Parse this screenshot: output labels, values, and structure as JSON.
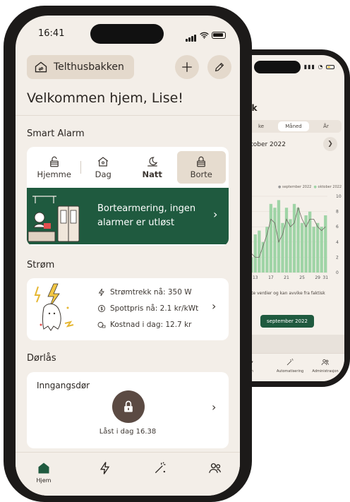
{
  "status_bar": {
    "time": "16:41"
  },
  "header": {
    "home_name": "Telthusbakken",
    "greeting": "Velkommen hjem, Lise!"
  },
  "smart_alarm": {
    "title": "Smart Alarm",
    "modes": [
      {
        "label": "Hjemme",
        "icon": "unlock-icon"
      },
      {
        "label": "Dag",
        "icon": "house-icon"
      },
      {
        "label": "Natt",
        "icon": "moon-icon"
      },
      {
        "label": "Borte",
        "icon": "lock-icon"
      }
    ],
    "active_mode": "Borte",
    "banner_text": "Bortearmering, ingen alarmer er utløst"
  },
  "strom": {
    "title": "Strøm",
    "rows": [
      {
        "text": "Strømtrekk nå: 350 W",
        "icon": "lightning-icon"
      },
      {
        "text": "Spottpris nå: 2.1 kr/kWt",
        "icon": "coin-icon"
      },
      {
        "text": "Kostnad i dag: 12.7 kr",
        "icon": "cost-icon"
      }
    ]
  },
  "dorlas": {
    "title": "Dørlås",
    "door_name": "Inngangsdør",
    "status": "Låst i dag 16.38"
  },
  "tabs": [
    {
      "label": "Hjem",
      "icon": "home-icon",
      "active": true
    },
    {
      "label": "",
      "icon": "lightning-icon"
    },
    {
      "label": "",
      "icon": "magic-wand-icon"
    },
    {
      "label": "",
      "icon": "users-icon"
    }
  ],
  "back_screen": {
    "title": "uk",
    "segments": [
      "ke",
      "Måned",
      "År"
    ],
    "active_segment": "Måned",
    "month": "ktober 2022",
    "legend": [
      "september 2022",
      "oktober 2022"
    ],
    "x_ticks": [
      "13",
      "17",
      "21",
      "25",
      "29",
      "31"
    ],
    "y_ticks": [
      "10",
      "8",
      "6",
      "4",
      "2",
      "0"
    ],
    "caption": "erte verdier og kan avvike fra faktisk",
    "button_label": "september 2022",
    "tabs": [
      "em",
      "Automatisering",
      "Administrasjon"
    ]
  },
  "colors": {
    "green": "#1f5a3f",
    "bar_green": "#9fd4a6",
    "brown": "#5b4a43",
    "beige": "#e4d9cc"
  },
  "chart_data": {
    "type": "bar",
    "x": [
      11,
      12,
      13,
      14,
      15,
      16,
      17,
      18,
      19,
      20,
      21,
      22,
      23,
      24,
      25,
      26,
      27,
      28,
      29,
      30,
      31
    ],
    "values": [
      3.5,
      2,
      5,
      5.5,
      4,
      6,
      9,
      8.5,
      9.5,
      6.5,
      8.5,
      7,
      9,
      8.5,
      6.5,
      7.5,
      8,
      6,
      6.5,
      6,
      7.5
    ],
    "series": [
      {
        "name": "oktober 2022",
        "values": [
          3.5,
          2,
          5,
          5.5,
          4,
          6,
          9,
          8.5,
          9.5,
          6.5,
          8.5,
          7,
          9,
          8.5,
          6.5,
          7.5,
          8,
          6,
          6.5,
          6,
          7.5
        ]
      },
      {
        "name": "september 2022",
        "values": [
          3,
          2.5,
          2,
          2,
          3.5,
          5,
          7,
          6.5,
          4,
          5,
          7,
          6,
          6.5,
          8.5,
          7,
          6,
          7,
          7,
          6,
          5.5,
          6
        ]
      }
    ],
    "ylim": [
      0,
      10
    ],
    "grid": true,
    "legend": "top-right"
  }
}
